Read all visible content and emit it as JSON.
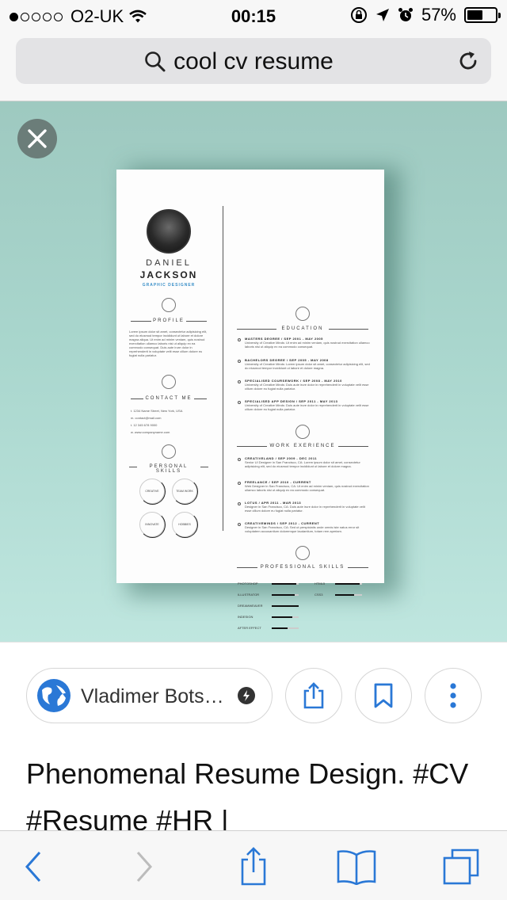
{
  "status_bar": {
    "signal_bars_filled": 1,
    "signal_bars_total": 5,
    "carrier": "O2-UK",
    "time": "00:15",
    "battery_percent_text": "57%",
    "battery_level": 0.57
  },
  "url_bar": {
    "query": "cool cv resume"
  },
  "resume": {
    "first_name": "DANIEL",
    "last_name": "JACKSON",
    "role": "GRAPHIC DESIGNER",
    "profile_title": "PROFILE",
    "profile_text": "Lorem ipsum dolor sit amet, consectetur adipisicing elit, sed do eiusmod tempor incididunt ut labore et dolore magna aliqua. Ut enim ad minim veniam, quis nostrud exercitation ullamco laboris nisi ut aliquip ex ea commodo consequat. Duis aute irure dolor in reprehenderit in voluptate velit esse cillum dolore eu fugiat nulla pariatur.",
    "contact_title": "CONTACT ME",
    "contacts": [
      "t.   1234 Name Street, New York, USA",
      "m.  contact@mail.com",
      "t.   12 345 678 9000",
      "w.  www.companyname.com"
    ],
    "personal_skills_title": "PERSONAL SKILLS",
    "personal_skills": [
      "CREATIVE",
      "TEAM WORK",
      "INNOVATE",
      "HOBBIES"
    ],
    "education_title": "EDUCATION",
    "education": [
      {
        "heading": "MASTERS DEGREE / SEP 2001 - MAY 2005",
        "text": "University of Creative Minds: Ut enim ad minim veniam, quis nostrud exercitation ullamco laboris nisi ut aliquip ex ea commodo consequat."
      },
      {
        "heading": "BACHELORS DEGREE / SEP 2005 - MAY 2008",
        "text": "University of Creative Minds: Lorem ipsum dolor sit amet, consectetur adipisicing elit, sed do eiusmod tempor incididunt ut labore et dolore magna."
      },
      {
        "heading": "SPECIALISED COURSEWORK / SEP 2008 - MAY 2010",
        "text": "University of Creative Minds: Duis aute irure dolor in reprehenderit in voluptate velit esse cillum dolore eu fugiat nulla pariatur."
      },
      {
        "heading": "SPECIALISED APP DESIGN / SEP 2011 - MAY 2013",
        "text": "University of Creative Minds: Duis aute irure dolor in reprehenderit in voluptate velit esse cillum dolore eu fugiat nulla pariatur."
      }
    ],
    "work_title": "WORK EXERIENCE",
    "work": [
      {
        "heading": "CREATIVELAND / SEP 2009 - DEC 2011",
        "text": "Senior UI Designer in San Francisco, CA: Lorem ipsum dolor sit amet, consectetur adipisicing elit, sed do eiusmod tempor incididunt ut labore et dolore magna."
      },
      {
        "heading": "FREELANCE / SEP 2010 - CURRENT",
        "text": "Web Designer in San Francisco, CA: Ut enim ad minim veniam, quis nostrud exercitation ullamco laboris nisi ut aliquip ex ea commodo consequat."
      },
      {
        "heading": "LOTUS / APR 2011 - MAR 2013",
        "text": "Designer in San Francisco, CA: Duis aute irure dolor in reprehenderit in voluptate velit esse cillum dolore eu fugiat nulla pariatur."
      },
      {
        "heading": "CREATIVEMINDS / SEP 2012 - CURRENT",
        "text": "Designer in San Francisco, CA: Sed ut perspiciatis unde omnis iste natus error sit voluptatem accusantium doloremque laudantium, totam rem aperiam."
      }
    ],
    "pro_skills_title": "PROFESSIONAL SKILLS",
    "pro_skills_left": [
      {
        "name": "PHOTOSHOP",
        "level": 0.9
      },
      {
        "name": "ILLUSTRATOR",
        "level": 0.85
      },
      {
        "name": "DREAMWEAVER",
        "level": 1.0
      },
      {
        "name": "INDESIGN",
        "level": 0.75
      },
      {
        "name": "AFTER EFFECT",
        "level": 0.6
      }
    ],
    "pro_skills_right": [
      {
        "name": "HTML5",
        "level": 0.9
      },
      {
        "name": "CSS3",
        "level": 0.7
      }
    ]
  },
  "attribution": {
    "source_name": "Vladimer Bots…",
    "caption": "Phenomenal Resume Design. #CV #Resume #HR |"
  },
  "colors": {
    "accent_blue": "#2a78d6",
    "role_blue": "#3a8fc8",
    "viewer_bg": "#a9d6cd"
  }
}
